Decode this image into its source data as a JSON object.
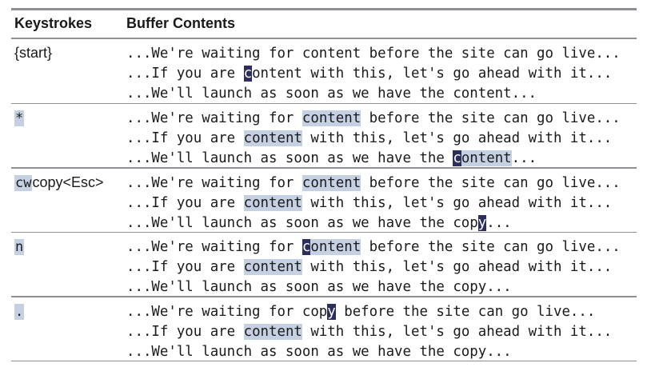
{
  "header": {
    "keystrokes": "Keystrokes",
    "buffer": "Buffer Contents"
  },
  "rows": [
    {
      "keys": [
        {
          "text": "{start}",
          "style": "plain"
        }
      ],
      "lines": [
        [
          {
            "t": "...We're waiting for content before the site can go live...",
            "s": "plain"
          }
        ],
        [
          {
            "t": "...If you are ",
            "s": "plain"
          },
          {
            "t": "c",
            "s": "cur"
          },
          {
            "t": "ontent with this, let's go ahead with it...",
            "s": "plain"
          }
        ],
        [
          {
            "t": "...We'll launch as soon as we have the content...",
            "s": "plain"
          }
        ]
      ]
    },
    {
      "keys": [
        {
          "text": "*",
          "style": "hl-mono"
        }
      ],
      "lines": [
        [
          {
            "t": "...We're waiting for ",
            "s": "plain"
          },
          {
            "t": "content",
            "s": "hl"
          },
          {
            "t": " before the site can go live...",
            "s": "plain"
          }
        ],
        [
          {
            "t": "...If you are ",
            "s": "plain"
          },
          {
            "t": "content",
            "s": "hl"
          },
          {
            "t": " with this, let's go ahead with it...",
            "s": "plain"
          }
        ],
        [
          {
            "t": "...We'll launch as soon as we have the ",
            "s": "plain"
          },
          {
            "t": "c",
            "s": "cur"
          },
          {
            "t": "ontent",
            "s": "hl"
          },
          {
            "t": "...",
            "s": "plain"
          }
        ]
      ]
    },
    {
      "keys": [
        {
          "text": "cw",
          "style": "hl-mono"
        },
        {
          "text": "copy<Esc>",
          "style": "plain"
        }
      ],
      "lines": [
        [
          {
            "t": "...We're waiting for ",
            "s": "plain"
          },
          {
            "t": "content",
            "s": "hl"
          },
          {
            "t": " before the site can go live...",
            "s": "plain"
          }
        ],
        [
          {
            "t": "...If you are ",
            "s": "plain"
          },
          {
            "t": "content",
            "s": "hl"
          },
          {
            "t": " with this, let's go ahead with it...",
            "s": "plain"
          }
        ],
        [
          {
            "t": "...We'll launch as soon as we have the cop",
            "s": "plain"
          },
          {
            "t": "y",
            "s": "cur"
          },
          {
            "t": "...",
            "s": "plain"
          }
        ]
      ]
    },
    {
      "keys": [
        {
          "text": "n",
          "style": "hl-mono"
        }
      ],
      "lines": [
        [
          {
            "t": "...We're waiting for ",
            "s": "plain"
          },
          {
            "t": "c",
            "s": "cur"
          },
          {
            "t": "ontent",
            "s": "hl"
          },
          {
            "t": " before the site can go live...",
            "s": "plain"
          }
        ],
        [
          {
            "t": "...If you are ",
            "s": "plain"
          },
          {
            "t": "content",
            "s": "hl"
          },
          {
            "t": " with this, let's go ahead with it...",
            "s": "plain"
          }
        ],
        [
          {
            "t": "...We'll launch as soon as we have the copy...",
            "s": "plain"
          }
        ]
      ]
    },
    {
      "keys": [
        {
          "text": ".",
          "style": "hl-mono"
        }
      ],
      "lines": [
        [
          {
            "t": "...We're waiting for cop",
            "s": "plain"
          },
          {
            "t": "y",
            "s": "cur"
          },
          {
            "t": " before the site can go live...",
            "s": "plain"
          }
        ],
        [
          {
            "t": "...If you are ",
            "s": "plain"
          },
          {
            "t": "content",
            "s": "hl"
          },
          {
            "t": " with this, let's go ahead with it...",
            "s": "plain"
          }
        ],
        [
          {
            "t": "...We'll launch as soon as we have the copy...",
            "s": "plain"
          }
        ]
      ]
    }
  ]
}
